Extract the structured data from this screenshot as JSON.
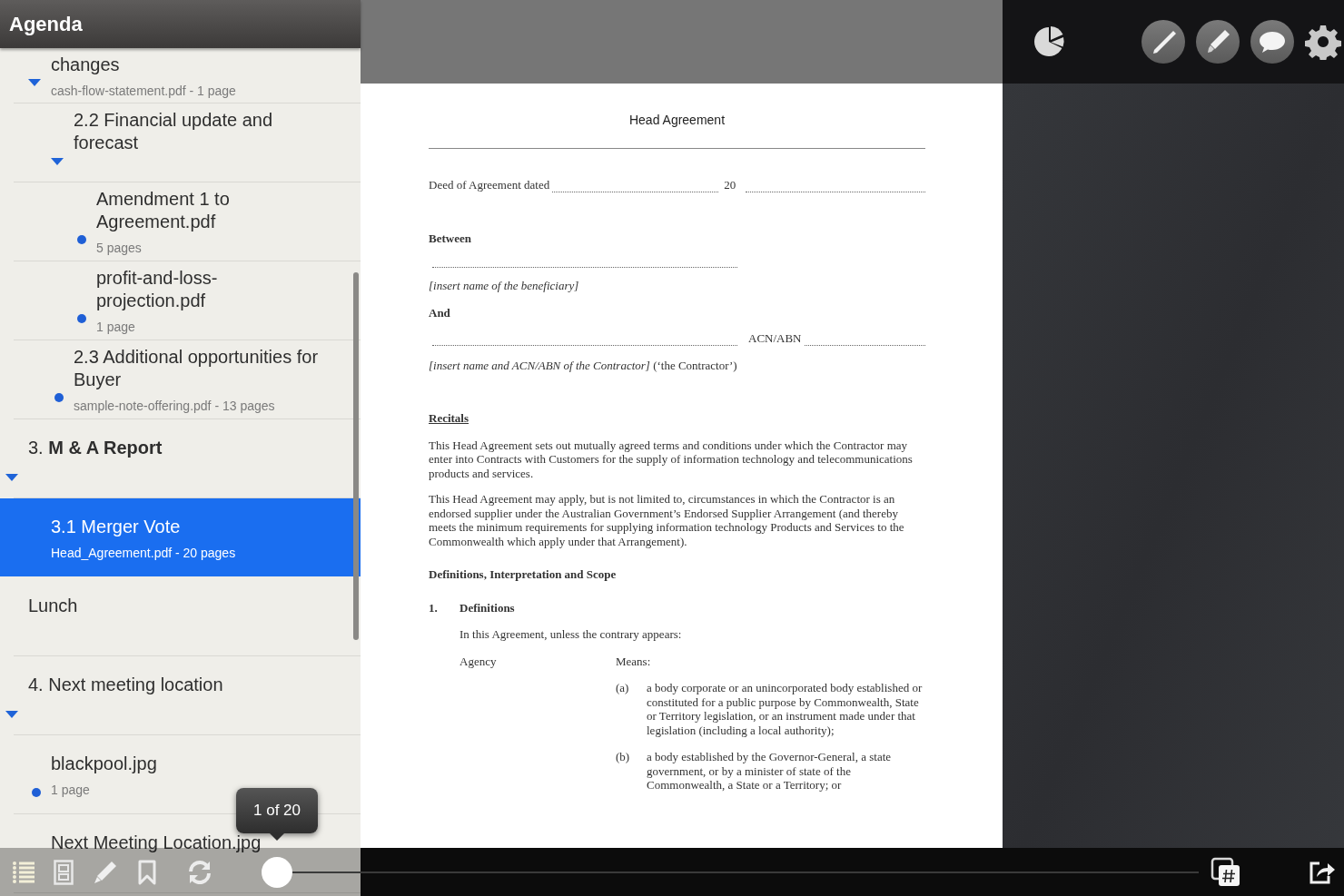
{
  "sidebar": {
    "title": "Agenda",
    "items": [
      {
        "title": "changes",
        "subtitle": "cash-flow-statement.pdf - 1 page",
        "kind": "caret",
        "selected": false,
        "children": [
          {
            "title": "2.2 Financial update and forecast",
            "kind": "caret",
            "selected": false,
            "children": [
              {
                "title": "Amendment 1 to Agreement.pdf",
                "subtitle": "5 pages",
                "kind": "dot",
                "selected": false
              },
              {
                "title": "profit-and-loss-projection.pdf",
                "subtitle": "1 page",
                "kind": "dot",
                "selected": false
              }
            ]
          },
          {
            "title": "2.3 Additional opportunities for Buyer",
            "subtitle": "sample-note-offering.pdf - 13 pages",
            "kind": "dot",
            "selected": false
          }
        ]
      },
      {
        "title": "3. **M & A Report**",
        "kind": "caret",
        "selected": false,
        "children": [
          {
            "title": "3.1 Merger Vote",
            "subtitle": "Head_Agreement.pdf - 20 pages",
            "kind": "plain",
            "selected": true
          }
        ]
      },
      {
        "title": "Lunch",
        "kind": "plain",
        "selected": false
      },
      {
        "title": "4. Next meeting location",
        "kind": "caret",
        "selected": false,
        "children": [
          {
            "title": "blackpool.jpg",
            "subtitle": "1 page",
            "kind": "dot",
            "selected": false
          },
          {
            "title": "Next Meeting Location.jpg",
            "kind": "plain",
            "selected": false
          }
        ]
      }
    ]
  },
  "page_indicator": "1 of 20",
  "page_slider": {
    "level": 0
  },
  "document": {
    "title": "Head Agreement",
    "blocks": [
      {
        "kind": "dated",
        "label": "Deed of Agreement dated",
        "year": "20"
      },
      {
        "kind": "heading",
        "text": "Between"
      },
      {
        "kind": "blank"
      },
      {
        "kind": "note",
        "text": "[insert name of the beneficiary]"
      },
      {
        "kind": "heading",
        "text": "And"
      },
      {
        "kind": "blank_labeled",
        "label": "ACN/ABN"
      },
      {
        "kind": "paragraph",
        "text": "*[insert name and ACN/ABN of the Contractor]* (‘the Contractor’)"
      },
      {
        "kind": "section",
        "text": "Recitals"
      },
      {
        "kind": "paragraph",
        "text": "This Head Agreement sets out mutually agreed terms and conditions under which the Contractor may enter into Contracts with Customers for the supply of information technology and telecommunications products and services."
      },
      {
        "kind": "paragraph",
        "text": "This Head Agreement may apply, but is not limited to, circumstances in which the Contractor is an endorsed supplier under the Australian Government’s Endorsed Supplier Arrangement (and thereby meets the minimum requirements for supplying information technology Products and Services to the Commonwealth which apply under that Arrangement)."
      },
      {
        "kind": "heading",
        "text": "Definitions, Interpretation and Scope"
      },
      {
        "kind": "numbered",
        "number": "1.",
        "text": "Definitions"
      },
      {
        "kind": "indented",
        "text": "In this Agreement, unless the contrary appears:"
      },
      {
        "kind": "term",
        "term": "Agency",
        "text": "Means:"
      },
      {
        "kind": "clause",
        "label": "(a)",
        "text": "a body corporate or an unincorporated body established or constituted for a public purpose by Commonwealth, State or Territory legislation, or an instrument made under that legislation (including a local authority);"
      },
      {
        "kind": "clause",
        "label": "(b)",
        "text": "a body established by the Governor-General, a state government, or by a minister of state of the Commonwealth, a State or a Territory; or"
      }
    ]
  }
}
